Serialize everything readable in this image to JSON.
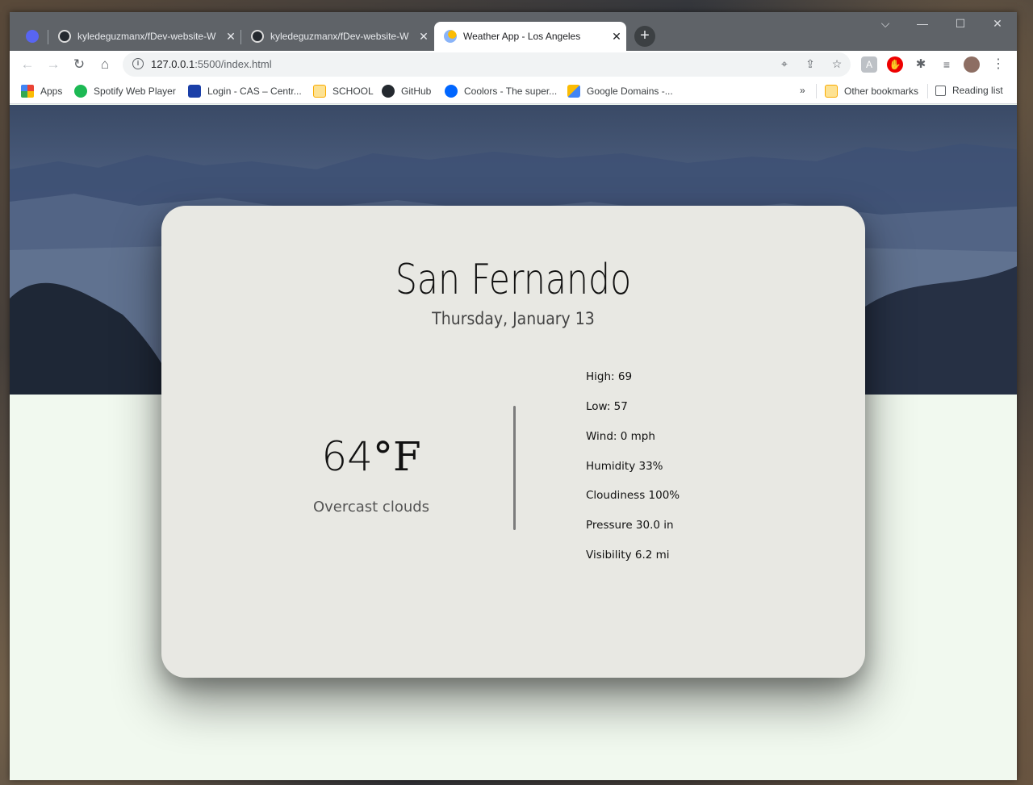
{
  "browser": {
    "tabs": [
      {
        "title": "",
        "icon": "discord-icon",
        "pinned": true
      },
      {
        "title": "kyledeguzmanx/fDev-website-W",
        "icon": "github-icon",
        "close": "✕"
      },
      {
        "title": "kyledeguzmanx/fDev-website-W",
        "icon": "github-icon",
        "close": "✕"
      },
      {
        "title": "Weather App - Los Angeles",
        "icon": "weather-icon",
        "close": "✕",
        "active": true
      }
    ],
    "new_tab": "+",
    "url_host": "127.0.0.1",
    "url_path": ":5500/index.html",
    "bookmarks": [
      {
        "label": "Apps",
        "icon": "apps-grid-icon"
      },
      {
        "label": "Spotify Web Player",
        "icon": "spotify-icon"
      },
      {
        "label": "Login - CAS – Centr...",
        "icon": "cas-icon"
      },
      {
        "label": "SCHOOL",
        "icon": "folder-icon"
      },
      {
        "label": "GitHub",
        "icon": "github-icon"
      },
      {
        "label": "Coolors - The super...",
        "icon": "coolors-icon"
      },
      {
        "label": "Google Domains -...",
        "icon": "google-domains-icon"
      }
    ],
    "overflow": "»",
    "other_bookmarks": "Other bookmarks",
    "reading_list": "Reading list"
  },
  "weather": {
    "city": "San Fernando",
    "date": "Thursday, January 13",
    "temp_value": "64",
    "temp_unit": "°F",
    "description": "Overcast clouds",
    "stats": [
      "High: 69",
      "Low: 57",
      "Wind: 0 mph",
      "Humidity 33%",
      "Cloudiness 100%",
      "Pressure 30.0 in",
      "Visibility 6.2 mi"
    ]
  },
  "colors": {
    "card_bg": "#e8e8e3",
    "page_bg": "#f1f9ef",
    "tabstrip": "#5f6368"
  }
}
